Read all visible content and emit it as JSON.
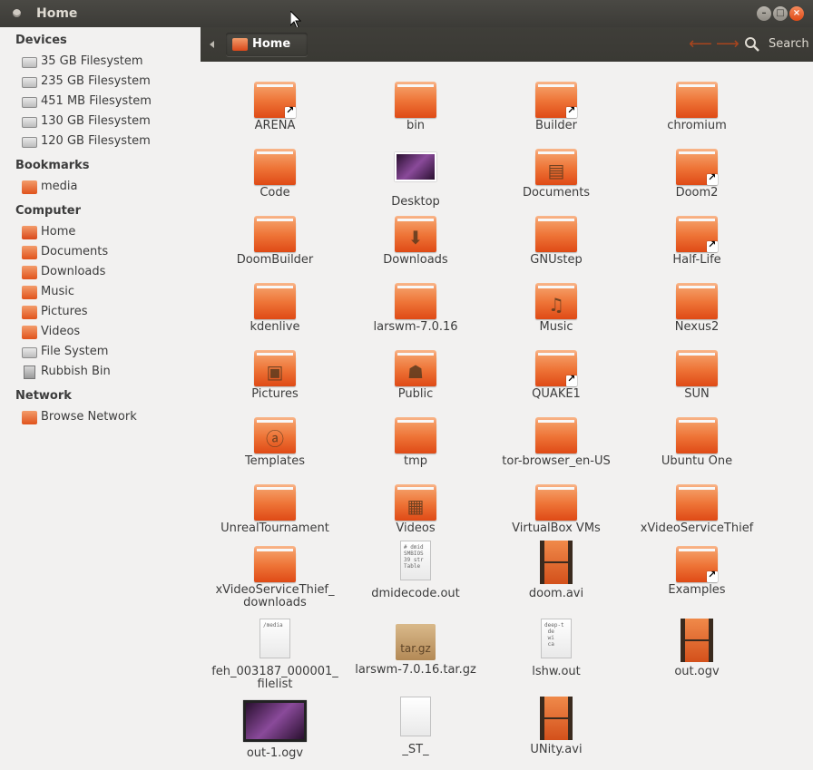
{
  "window": {
    "title": "Home"
  },
  "sidebar": {
    "devices_heading": "Devices",
    "devices": [
      {
        "label": "35 GB Filesystem",
        "icon": "drive-icon"
      },
      {
        "label": "235 GB Filesystem",
        "icon": "drive-icon"
      },
      {
        "label": "451 MB Filesystem",
        "icon": "drive-icon"
      },
      {
        "label": "130 GB Filesystem",
        "icon": "drive-icon"
      },
      {
        "label": "120 GB Filesystem",
        "icon": "usb-drive-icon"
      }
    ],
    "bookmarks_heading": "Bookmarks",
    "bookmarks": [
      {
        "label": "media",
        "icon": "folder-icon"
      }
    ],
    "computer_heading": "Computer",
    "computer": [
      {
        "label": "Home",
        "icon": "home-folder-icon"
      },
      {
        "label": "Documents",
        "icon": "documents-folder-icon"
      },
      {
        "label": "Downloads",
        "icon": "downloads-folder-icon"
      },
      {
        "label": "Music",
        "icon": "music-folder-icon"
      },
      {
        "label": "Pictures",
        "icon": "pictures-folder-icon"
      },
      {
        "label": "Videos",
        "icon": "videos-folder-icon"
      },
      {
        "label": "File System",
        "icon": "filesystem-icon"
      },
      {
        "label": "Rubbish Bin",
        "icon": "trash-icon"
      }
    ],
    "network_heading": "Network",
    "network": [
      {
        "label": "Browse Network",
        "icon": "network-icon"
      }
    ]
  },
  "toolbar": {
    "breadcrumb": "Home",
    "search_label": "Search"
  },
  "files": [
    {
      "name": "ARENA",
      "kind": "folder-link"
    },
    {
      "name": "bin",
      "kind": "folder"
    },
    {
      "name": "Builder",
      "kind": "folder-link"
    },
    {
      "name": "chromium",
      "kind": "folder"
    },
    {
      "name": "Code",
      "kind": "folder"
    },
    {
      "name": "Desktop",
      "kind": "desktop"
    },
    {
      "name": "Documents",
      "kind": "folder-documents"
    },
    {
      "name": "Doom2",
      "kind": "folder-link"
    },
    {
      "name": "DoomBuilder",
      "kind": "folder"
    },
    {
      "name": "Downloads",
      "kind": "folder-downloads"
    },
    {
      "name": "GNUstep",
      "kind": "folder"
    },
    {
      "name": "Half-Life",
      "kind": "folder-link"
    },
    {
      "name": "kdenlive",
      "kind": "folder"
    },
    {
      "name": "larswm-7.0.16",
      "kind": "folder"
    },
    {
      "name": "Music",
      "kind": "folder-music"
    },
    {
      "name": "Nexus2",
      "kind": "folder"
    },
    {
      "name": "Pictures",
      "kind": "folder-pictures"
    },
    {
      "name": "Public",
      "kind": "folder-public"
    },
    {
      "name": "QUAKE1",
      "kind": "folder-link"
    },
    {
      "name": "SUN",
      "kind": "folder"
    },
    {
      "name": "Templates",
      "kind": "folder-templates"
    },
    {
      "name": "tmp",
      "kind": "folder"
    },
    {
      "name": "tor-browser_en-US",
      "kind": "folder"
    },
    {
      "name": "Ubuntu One",
      "kind": "folder"
    },
    {
      "name": "UnrealTournament",
      "kind": "folder"
    },
    {
      "name": "Videos",
      "kind": "folder-videos"
    },
    {
      "name": "VirtualBox VMs",
      "kind": "folder"
    },
    {
      "name": "xVideoServiceThief",
      "kind": "folder"
    },
    {
      "name": "xVideoServiceThief_\ndownloads",
      "kind": "folder"
    },
    {
      "name": "dmidecode.out",
      "kind": "text",
      "preview": "# dmid\nSMBIOS\n39 str\nTable"
    },
    {
      "name": "doom.avi",
      "kind": "video"
    },
    {
      "name": "Examples",
      "kind": "folder-link"
    },
    {
      "name": "feh_003187_000001_\nfilelist",
      "kind": "text",
      "preview": "/media"
    },
    {
      "name": "larswm-7.0.16.tar.gz",
      "kind": "archive",
      "preview": "tar.gz"
    },
    {
      "name": "lshw.out",
      "kind": "text",
      "preview": "deep-t\n de\n wi\n ca"
    },
    {
      "name": "out.ogv",
      "kind": "video"
    },
    {
      "name": "out-1.ogv",
      "kind": "video-thumb"
    },
    {
      "name": "_ST_",
      "kind": "text",
      "preview": ""
    },
    {
      "name": "UNity.avi",
      "kind": "video"
    }
  ]
}
